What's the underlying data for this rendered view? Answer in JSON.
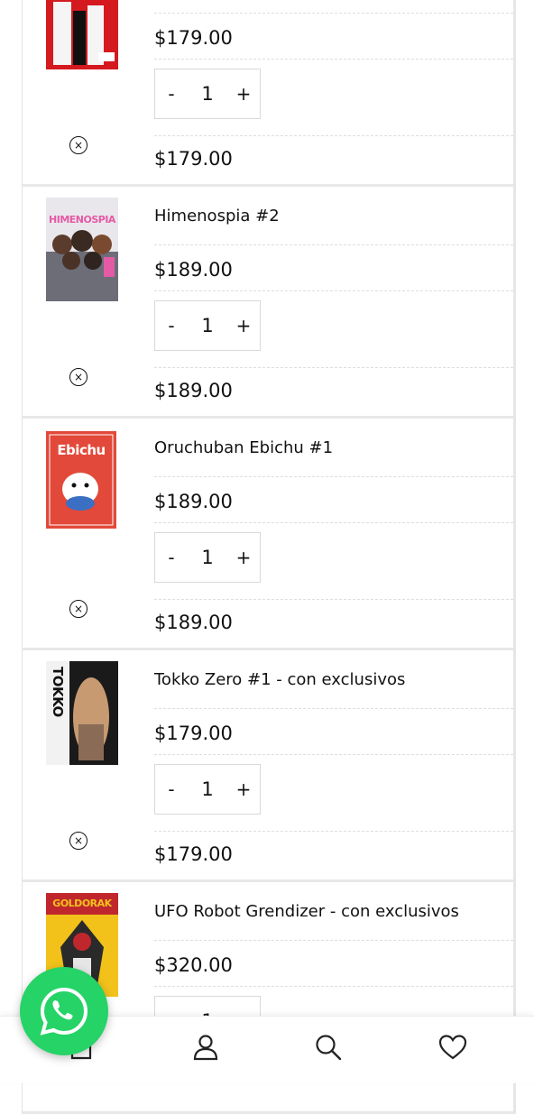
{
  "cart": {
    "quantity_controls": {
      "minus_label": "-",
      "plus_label": "+"
    },
    "remove_icon_glyph": "×",
    "items": [
      {
        "name": "",
        "price": "$179.00",
        "quantity": "1",
        "subtotal": "$179.00",
        "cover": {
          "bg": "#d4191f",
          "accent": "#f6d04b",
          "icon": "manga-cover-kanji"
        }
      },
      {
        "name": "Himenospia #2",
        "price": "$189.00",
        "quantity": "1",
        "subtotal": "$189.00",
        "cover": {
          "bg": "#cfcfd6",
          "accent": "#e55aa5",
          "title_text": "HIMENOSPIA",
          "icon": "manga-cover-himenospia"
        }
      },
      {
        "name": "Oruchuban Ebichu #1",
        "price": "$189.00",
        "quantity": "1",
        "subtotal": "$189.00",
        "cover": {
          "bg": "#e2493a",
          "accent": "#ffffff",
          "title_text": "Ebichu",
          "icon": "manga-cover-ebichu"
        }
      },
      {
        "name": "Tokko Zero #1 - con exclusivos",
        "price": "$179.00",
        "quantity": "1",
        "subtotal": "$179.00",
        "cover": {
          "bg": "#1a1a1a",
          "accent": "#c79a72",
          "title_text": "TOKKO",
          "icon": "manga-cover-tokko"
        }
      },
      {
        "name": "UFO Robot Grendizer - con exclusivos",
        "price": "$320.00",
        "quantity": "1",
        "subtotal": "",
        "cover": {
          "bg": "#f2c21b",
          "accent": "#c0272d",
          "title_text": "GOLDORAK",
          "icon": "manga-cover-goldorak"
        }
      }
    ]
  },
  "whatsapp": {
    "icon": "whatsapp-icon",
    "color": "#25d366"
  },
  "bottom_nav": {
    "items": [
      {
        "icon": "home-icon"
      },
      {
        "icon": "user-icon"
      },
      {
        "icon": "search-icon"
      },
      {
        "icon": "heart-icon"
      }
    ]
  }
}
